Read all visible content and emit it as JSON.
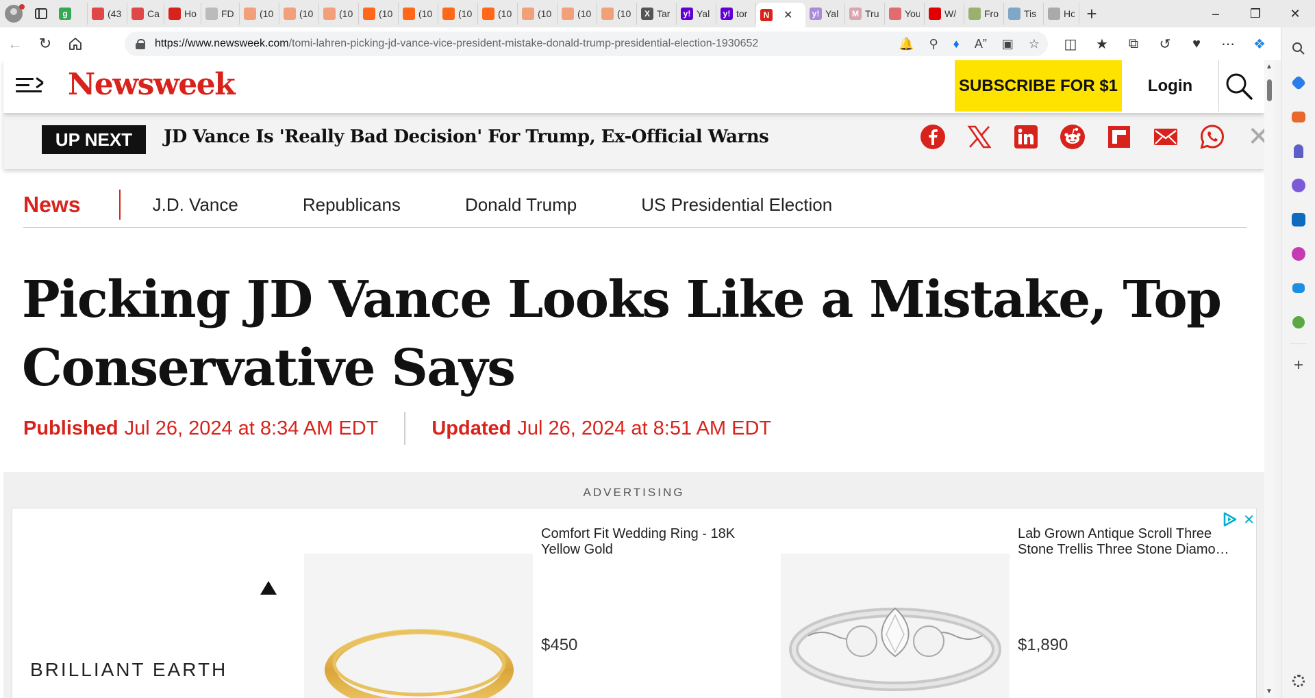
{
  "browser": {
    "tabs": [
      {
        "title": "",
        "fav": "g",
        "color": "#34a853"
      },
      {
        "title": "(43",
        "fav": "",
        "color": "#e04848"
      },
      {
        "title": "Cai",
        "fav": "",
        "color": "#e04848"
      },
      {
        "title": "Ho",
        "fav": "",
        "color": "#d8231c"
      },
      {
        "title": "FD.",
        "fav": "",
        "color": "#bbbbbb"
      },
      {
        "title": "(10",
        "fav": "",
        "color": "#f2a07a"
      },
      {
        "title": "(10",
        "fav": "",
        "color": "#f2a07a"
      },
      {
        "title": "(10",
        "fav": "",
        "color": "#f2a07a"
      },
      {
        "title": "(10",
        "fav": "",
        "color": "#ff6719"
      },
      {
        "title": "(10",
        "fav": "",
        "color": "#ff6719"
      },
      {
        "title": "(10",
        "fav": "",
        "color": "#ff6719"
      },
      {
        "title": "(10",
        "fav": "",
        "color": "#ff6719"
      },
      {
        "title": "(10",
        "fav": "",
        "color": "#f2a07a"
      },
      {
        "title": "(10",
        "fav": "",
        "color": "#f2a07a"
      },
      {
        "title": "(10",
        "fav": "",
        "color": "#f2a07a"
      },
      {
        "title": "Tar",
        "fav": "X",
        "color": "#555555"
      },
      {
        "title": "Yal",
        "fav": "y!",
        "color": "#6001d2"
      },
      {
        "title": "tor",
        "fav": "y!",
        "color": "#6001d2"
      },
      {
        "title": "",
        "fav": "N",
        "color": "#d8231c"
      },
      {
        "title": "Yal",
        "fav": "y!",
        "color": "#a98bd8"
      },
      {
        "title": "Tru",
        "fav": "M",
        "color": "#d9a6b0"
      },
      {
        "title": "You",
        "fav": "",
        "color": "#e06c6c"
      },
      {
        "title": "W/",
        "fav": "",
        "color": "#e00000"
      },
      {
        "title": "Fro",
        "fav": "",
        "color": "#9bb06e"
      },
      {
        "title": "Tis",
        "fav": "",
        "color": "#7fa7c8"
      },
      {
        "title": "Ho",
        "fav": "",
        "color": "#aaaaaa"
      }
    ],
    "url_domain": "https://www.newsweek.com",
    "url_path": "/tomi-lahren-picking-jd-vance-vice-president-mistake-donald-trump-presidential-election-1930652"
  },
  "header": {
    "logo": "Newsweek",
    "subscribe": "SUBSCRIBE FOR $1",
    "login": "Login"
  },
  "up_next": {
    "tag": "UP NEXT",
    "headline": "JD Vance Is 'Really Bad Decision' For Trump, Ex-Official Warns"
  },
  "topics": {
    "section": "News",
    "items": [
      "J.D. Vance",
      "Republicans",
      "Donald Trump",
      "US Presidential Election"
    ]
  },
  "article": {
    "title": "Picking JD Vance Looks Like a Mistake, Top Conservative Says",
    "published_label": "Published",
    "published_date": "Jul 26, 2024 at 8:34 AM EDT",
    "updated_label": "Updated",
    "updated_date": "Jul 26, 2024 at 8:51 AM EDT"
  },
  "ad": {
    "label": "ADVERTISING",
    "brand": "BRILLIANT EARTH",
    "products": [
      {
        "title": "Comfort Fit Wedding Ring - 18K Yellow Gold",
        "price": "$450"
      },
      {
        "title": "Lab Grown Antique Scroll Three Stone Trellis Three Stone Diamo…",
        "price": "$1,890"
      }
    ]
  },
  "colors": {
    "brand_red": "#d8231c",
    "subscribe_yellow": "#ffe300"
  }
}
